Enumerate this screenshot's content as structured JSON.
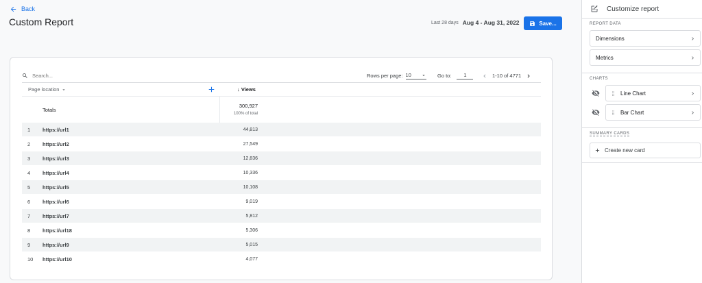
{
  "header": {
    "back_label": "Back",
    "title": "Custom Report",
    "date_range_label": "Last 28 days",
    "date_range_value": "Aug 4 - Aug 31, 2022",
    "save_label": "Save..."
  },
  "toolbar": {
    "search_placeholder": "Search...",
    "rows_per_page_label": "Rows per page:",
    "rows_per_page_value": "10",
    "goto_label": "Go to:",
    "goto_value": "1",
    "pagination_text": "1-10 of 4771"
  },
  "table": {
    "dimension_header": "Page location",
    "metric_header": "↓ Views",
    "totals_label": "Totals",
    "totals_value": "300,927",
    "totals_pct": "100% of total",
    "rows": [
      {
        "idx": "1",
        "dim": "https://url1",
        "val": "44,813"
      },
      {
        "idx": "2",
        "dim": "https://url2",
        "val": "27,549"
      },
      {
        "idx": "3",
        "dim": "https://url3",
        "val": "12,836"
      },
      {
        "idx": "4",
        "dim": "https://url4",
        "val": "10,336"
      },
      {
        "idx": "5",
        "dim": "https://url5",
        "val": "10,108"
      },
      {
        "idx": "6",
        "dim": "https://url6",
        "val": "9,019"
      },
      {
        "idx": "7",
        "dim": "https://url7",
        "val": "5,812"
      },
      {
        "idx": "8",
        "dim": "https://url18",
        "val": "5,306"
      },
      {
        "idx": "9",
        "dim": "https://url9",
        "val": "5,015"
      },
      {
        "idx": "10",
        "dim": "https://url10",
        "val": "4,077"
      }
    ]
  },
  "panel": {
    "title": "Customize report",
    "report_data_title": "REPORT DATA",
    "dimensions_label": "Dimensions",
    "metrics_label": "Metrics",
    "charts_title": "CHARTS",
    "line_chart_label": "Line Chart",
    "bar_chart_label": "Bar Chart",
    "summary_cards_title": "SUMMARY CARDS",
    "create_card_label": "Create new card"
  },
  "colors": {
    "accent": "#1a73e8",
    "row_stripe": "#f1f3f4",
    "border": "#dadce0"
  }
}
